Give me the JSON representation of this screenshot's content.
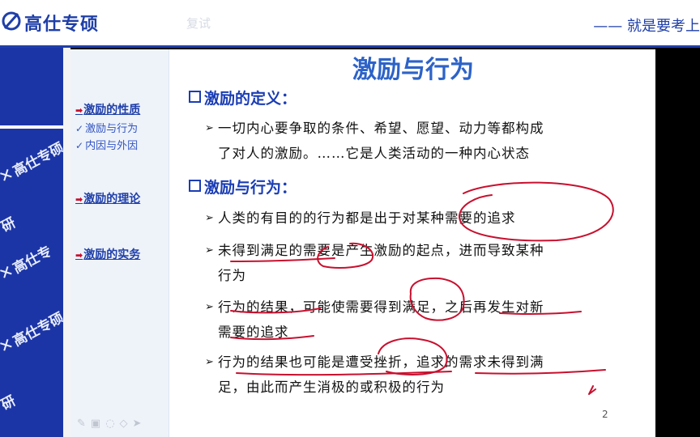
{
  "header": {
    "brand": "高仕专硕",
    "ghost_text": "复试",
    "slogan": "—— 就是要考上"
  },
  "watermark": {
    "text": "高仕专硕",
    "partial_1": "研",
    "partial_2": "高仕专",
    "partial_3": "研"
  },
  "slide": {
    "title": "激励与行为",
    "page_number": "2",
    "nav": {
      "item1": "激励的性质",
      "sub1": "激励与行为",
      "sub2": "内因与外因",
      "item2": "激励的理论",
      "item3": "激励的实务"
    },
    "section1": {
      "heading": "激励的定义：",
      "bullet1_line1": "一切内心要争取的条件、希望、愿望、动力等都构成",
      "bullet1_line2": "了对人的激励。……它是人类活动的一种内心状态"
    },
    "section2": {
      "heading": "激励与行为：",
      "b1": "人类的有目的的行为都是出于对某种需要的追求",
      "b2_line1": "未得到满足的需要是产生激励的起点，进而导致某种",
      "b2_line2": "行为",
      "b3_line1": "行为的结果，可能使需要得到满足，之后再发生对新",
      "b3_line2": "需要的追求",
      "b4_line1": "行为的结果也可能是遭受挫折，追求的需求未得到满",
      "b4_line2": "足，由此而产生消极的或积极的行为"
    },
    "toolbar_icons": [
      "pen-icon",
      "slides-icon",
      "chat-icon",
      "eraser-icon",
      "pointer-icon"
    ]
  },
  "colors": {
    "brand_blue": "#1f3fa8",
    "ink_red": "#c8102e",
    "title_blue": "#2d63c8"
  }
}
